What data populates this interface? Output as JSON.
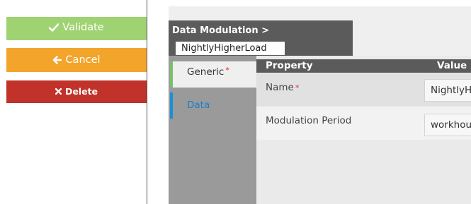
{
  "actions": {
    "validate_label": "Validate",
    "cancel_label": "Cancel",
    "delete_label": "Delete",
    "validate_icon": "check-icon",
    "cancel_icon": "arrow-left-icon",
    "delete_icon": "x-icon"
  },
  "header": {
    "breadcrumb": "Data Modulation >",
    "record_name": "NightlyHigherLoad"
  },
  "tabs": [
    {
      "label": "Generic",
      "required_marker": "*"
    },
    {
      "label": "Data"
    }
  ],
  "table": {
    "columns": [
      "Property",
      "Value"
    ],
    "rows": [
      {
        "property": "Name",
        "required_marker": "*",
        "value": "NightlyHigherLoad"
      },
      {
        "property": "Modulation Period",
        "value": "workhours"
      }
    ]
  },
  "colors": {
    "validate": "#9fd372",
    "cancel": "#f2a42b",
    "delete": "#c0322a",
    "header_bg": "#5b5b5b",
    "tab_active_marker": "#7bbf6a",
    "tab_link": "#1a7fc9",
    "required": "#e02020"
  }
}
